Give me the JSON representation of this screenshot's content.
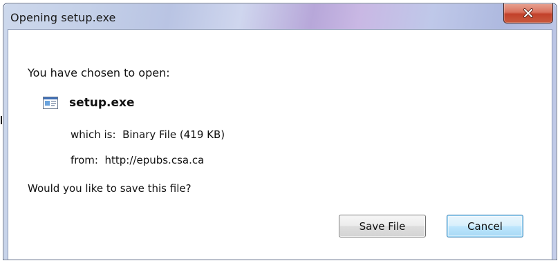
{
  "dialog": {
    "title": "Opening setup.exe",
    "prompt": "You have chosen to open:",
    "file": {
      "name": "setup.exe",
      "icon": "application-file-icon",
      "type_label": "which is:",
      "type_value": "Binary File (419 KB)",
      "source_label": "from:",
      "source_value": "http://epubs.csa.ca"
    },
    "question": "Would you like to save this file?",
    "buttons": {
      "save": "Save File",
      "cancel": "Cancel"
    },
    "close_icon": "close-icon"
  },
  "colors": {
    "close_button": "#c7452e",
    "default_button_border": "#3c7fb1",
    "frame_border": "#5d6a86"
  }
}
